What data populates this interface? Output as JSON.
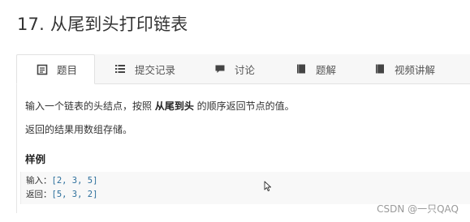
{
  "page": {
    "title": "17. 从尾到头打印链表"
  },
  "tabs": [
    {
      "label": "题目",
      "icon": "description-icon",
      "active": true
    },
    {
      "label": "提交记录",
      "icon": "list-icon",
      "active": false
    },
    {
      "label": "讨论",
      "icon": "chat-icon",
      "active": false
    },
    {
      "label": "题解",
      "icon": "book-icon",
      "active": false
    },
    {
      "label": "视频讲解",
      "icon": "book-icon",
      "active": false
    }
  ],
  "problem": {
    "line1_prefix": "输入一个链表的头结点，按照 ",
    "line1_bold": "从尾到头",
    "line1_suffix": " 的顺序返回节点的值。",
    "line2": "返回的结果用数组存储。",
    "example_heading": "样例",
    "example": {
      "input_label": "输入：",
      "input_value": "[2, 3, 5]",
      "output_label": "返回：",
      "output_value": "[5, 3, 2]"
    }
  },
  "watermark": "CSDN @一只QAQ",
  "colors": {
    "tab_bar_bg": "#f7f7f7",
    "code_bg": "#f8f8f8",
    "code_text": "#2b6e9b",
    "title_text": "#333333",
    "icon_dark": "#444444"
  }
}
